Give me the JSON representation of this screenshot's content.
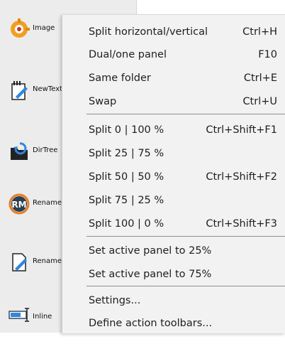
{
  "toolbar": {
    "items": [
      {
        "label": "Image",
        "icon": "image-tool-icon"
      },
      {
        "label": "NewText",
        "icon": "new-file-icon"
      },
      {
        "label": "DirTree",
        "icon": "dir-tree-icon"
      },
      {
        "label": "Rename",
        "icon": "rename-rm-icon"
      },
      {
        "label": "Rename",
        "icon": "rename-file-icon"
      },
      {
        "label": "Inline",
        "icon": "inline-rename-icon"
      }
    ]
  },
  "menu": {
    "groups": [
      [
        {
          "label": "Split horizontal/vertical",
          "shortcut": "Ctrl+H"
        },
        {
          "label": "Dual/one panel",
          "shortcut": "F10"
        },
        {
          "label": "Same folder",
          "shortcut": "Ctrl+E"
        },
        {
          "label": "Swap",
          "shortcut": "Ctrl+U"
        }
      ],
      [
        {
          "label": "Split 0 | 100 %",
          "shortcut": "Ctrl+Shift+F1"
        },
        {
          "label": "Split 25 | 75 %",
          "shortcut": ""
        },
        {
          "label": "Split 50 | 50 %",
          "shortcut": "Ctrl+Shift+F2"
        },
        {
          "label": "Split 75 | 25 %",
          "shortcut": ""
        },
        {
          "label": "Split 100 | 0 %",
          "shortcut": "Ctrl+Shift+F3"
        }
      ],
      [
        {
          "label": "Set active panel to 25%",
          "shortcut": ""
        },
        {
          "label": "Set active panel to 75%",
          "shortcut": ""
        }
      ],
      [
        {
          "label": "Settings...",
          "shortcut": ""
        },
        {
          "label": "Define action toolbars...",
          "shortcut": ""
        }
      ]
    ]
  }
}
